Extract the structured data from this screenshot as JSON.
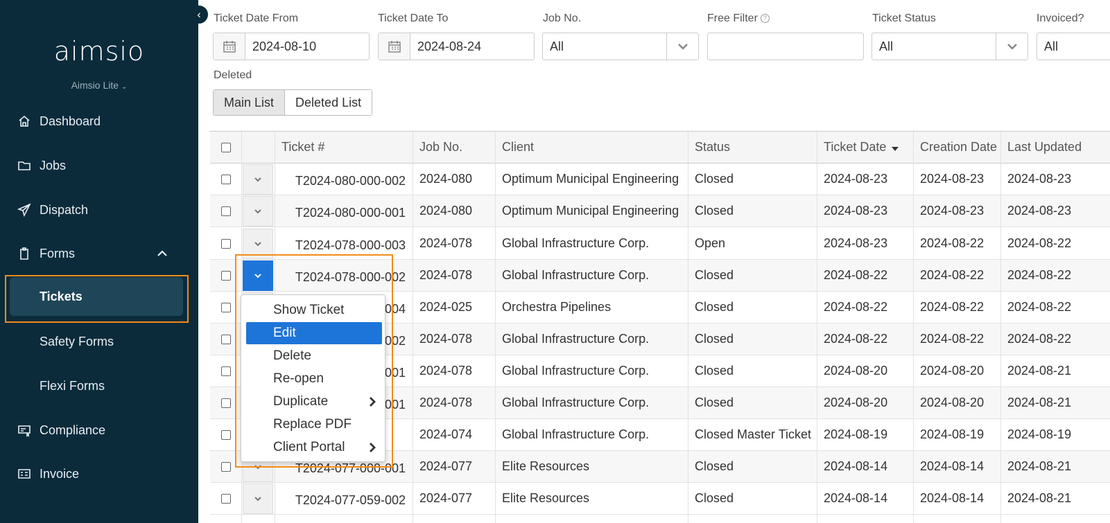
{
  "sidebar": {
    "logo": "aimsio",
    "app_name": "Aimsio Lite",
    "collapse_glyph": "‹",
    "nav": [
      {
        "label": "Dashboard",
        "icon": "home-icon"
      },
      {
        "label": "Jobs",
        "icon": "folder-icon"
      },
      {
        "label": "Dispatch",
        "icon": "paper-plane-icon"
      },
      {
        "label": "Forms",
        "icon": "clipboard-icon"
      },
      {
        "label": "Compliance",
        "icon": "certificate-icon"
      },
      {
        "label": "Invoice",
        "icon": "invoice-icon"
      }
    ],
    "forms_sub": [
      {
        "label": "Tickets",
        "active": true
      },
      {
        "label": "Safety Forms"
      },
      {
        "label": "Flexi Forms"
      }
    ]
  },
  "filters": {
    "date_from": {
      "label": "Ticket Date From",
      "value": "2024-08-10"
    },
    "date_to": {
      "label": "Ticket Date To",
      "value": "2024-08-24"
    },
    "job_no": {
      "label": "Job No.",
      "value": "All"
    },
    "free_filter": {
      "label": "Free Filter",
      "value": ""
    },
    "ticket_status": {
      "label": "Ticket Status",
      "value": "All"
    },
    "invoiced": {
      "label": "Invoiced?",
      "value": "All"
    },
    "deleted": {
      "label": "Deleted",
      "options": [
        "Main List",
        "Deleted List"
      ],
      "selected": "Main List"
    }
  },
  "table": {
    "columns": [
      "Ticket #",
      "Job No.",
      "Client",
      "Status",
      "Ticket Date",
      "Creation Date",
      "Last Updated"
    ],
    "sorted_column": "Ticket Date",
    "rows": [
      {
        "ticket": "T2024-080-000-002",
        "job": "2024-080",
        "client": "Optimum Municipal Engineering",
        "status": "Closed",
        "ticket_date": "2024-08-23",
        "created": "2024-08-23",
        "updated": "2024-08-23"
      },
      {
        "ticket": "T2024-080-000-001",
        "job": "2024-080",
        "client": "Optimum Municipal Engineering",
        "status": "Closed",
        "ticket_date": "2024-08-23",
        "created": "2024-08-23",
        "updated": "2024-08-23"
      },
      {
        "ticket": "T2024-078-000-003",
        "job": "2024-078",
        "client": "Global Infrastructure Corp.",
        "status": "Open",
        "ticket_date": "2024-08-23",
        "created": "2024-08-22",
        "updated": "2024-08-22"
      },
      {
        "ticket": "T2024-078-000-002",
        "job": "2024-078",
        "client": "Global Infrastructure Corp.",
        "status": "Closed",
        "ticket_date": "2024-08-22",
        "created": "2024-08-22",
        "updated": "2024-08-22"
      },
      {
        "ticket": "004",
        "job": "2024-025",
        "client": "Orchestra Pipelines",
        "status": "Closed",
        "ticket_date": "2024-08-22",
        "created": "2024-08-22",
        "updated": "2024-08-22"
      },
      {
        "ticket": "002",
        "job": "2024-078",
        "client": "Global Infrastructure Corp.",
        "status": "Closed",
        "ticket_date": "2024-08-22",
        "created": "2024-08-22",
        "updated": "2024-08-22"
      },
      {
        "ticket": "001",
        "job": "2024-078",
        "client": "Global Infrastructure Corp.",
        "status": "Closed",
        "ticket_date": "2024-08-20",
        "created": "2024-08-20",
        "updated": "2024-08-21"
      },
      {
        "ticket": "001",
        "job": "2024-078",
        "client": "Global Infrastructure Corp.",
        "status": "Closed",
        "ticket_date": "2024-08-20",
        "created": "2024-08-20",
        "updated": "2024-08-21"
      },
      {
        "ticket": "",
        "job": "2024-074",
        "client": "Global Infrastructure Corp.",
        "status": "Closed Master Ticket",
        "ticket_date": "2024-08-19",
        "created": "2024-08-19",
        "updated": "2024-08-19"
      },
      {
        "ticket": "T2024-077-000-001",
        "job": "2024-077",
        "client": "Elite Resources",
        "status": "Closed",
        "ticket_date": "2024-08-14",
        "created": "2024-08-14",
        "updated": "2024-08-21"
      },
      {
        "ticket": "T2024-077-059-002",
        "job": "2024-077",
        "client": "Elite Resources",
        "status": "Closed",
        "ticket_date": "2024-08-14",
        "created": "2024-08-14",
        "updated": "2024-08-21"
      }
    ]
  },
  "context_menu": {
    "items": [
      {
        "label": "Show Ticket"
      },
      {
        "label": "Edit",
        "selected": true
      },
      {
        "label": "Delete"
      },
      {
        "label": "Re-open"
      },
      {
        "label": "Duplicate",
        "submenu": true
      },
      {
        "label": "Replace PDF"
      },
      {
        "label": "Client Portal",
        "submenu": true
      }
    ]
  },
  "colors": {
    "sidebar_bg": "#0b2b3b",
    "active_nav_bg": "#1f4558",
    "accent_blue": "#1e75d9",
    "highlight_orange": "#f28c18"
  }
}
